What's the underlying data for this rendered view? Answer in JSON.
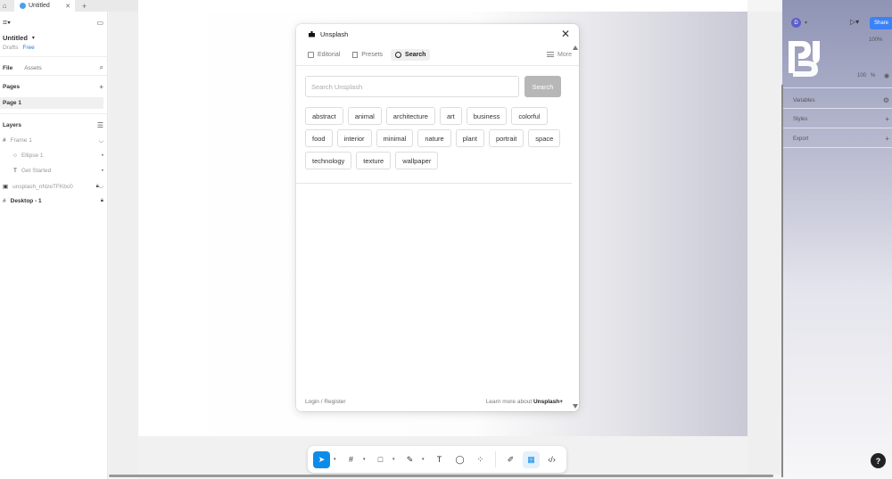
{
  "browser": {
    "tab_title": "Untitled",
    "new_tab": "+"
  },
  "left_panel": {
    "file_name": "Untitled",
    "drafts": "Drafts",
    "plan": "Free",
    "tabs": [
      "File",
      "Assets"
    ],
    "pages_label": "Pages",
    "pages": [
      "Page 1"
    ],
    "layers_label": "Layers",
    "layers": [
      {
        "name": "Frame 1",
        "indent": 0
      },
      {
        "name": "Ellipse 1",
        "indent": 1
      },
      {
        "name": "Get Started",
        "indent": 1
      },
      {
        "name": "unsplash_nNzeTFKbc0",
        "indent": 0
      },
      {
        "name": "Desktop - 1",
        "indent": 0
      }
    ]
  },
  "right_panel": {
    "avatar_letter": "D",
    "share": "Share",
    "zoom": "100%",
    "opacity": "100",
    "pct": "%",
    "variables": "Variables",
    "styles": "Styles",
    "export": "Export"
  },
  "plugin": {
    "title": "Unsplash",
    "tabs": [
      "Editorial",
      "Presets",
      "Search"
    ],
    "active_tab": "Search",
    "more": "More",
    "search_placeholder": "Search Unsplash",
    "search_button": "Search",
    "tags": [
      "abstract",
      "animal",
      "architecture",
      "art",
      "business",
      "colorful",
      "food",
      "interior",
      "minimal",
      "nature",
      "plant",
      "portrait",
      "space",
      "technology",
      "texture",
      "wallpaper"
    ],
    "login": "Login / Register",
    "learn_more": "Learn more about",
    "learn_brand": "Unsplash+"
  },
  "help": "?",
  "colors": {
    "accent": "#0c8ce9",
    "share": "#3b82f6"
  }
}
